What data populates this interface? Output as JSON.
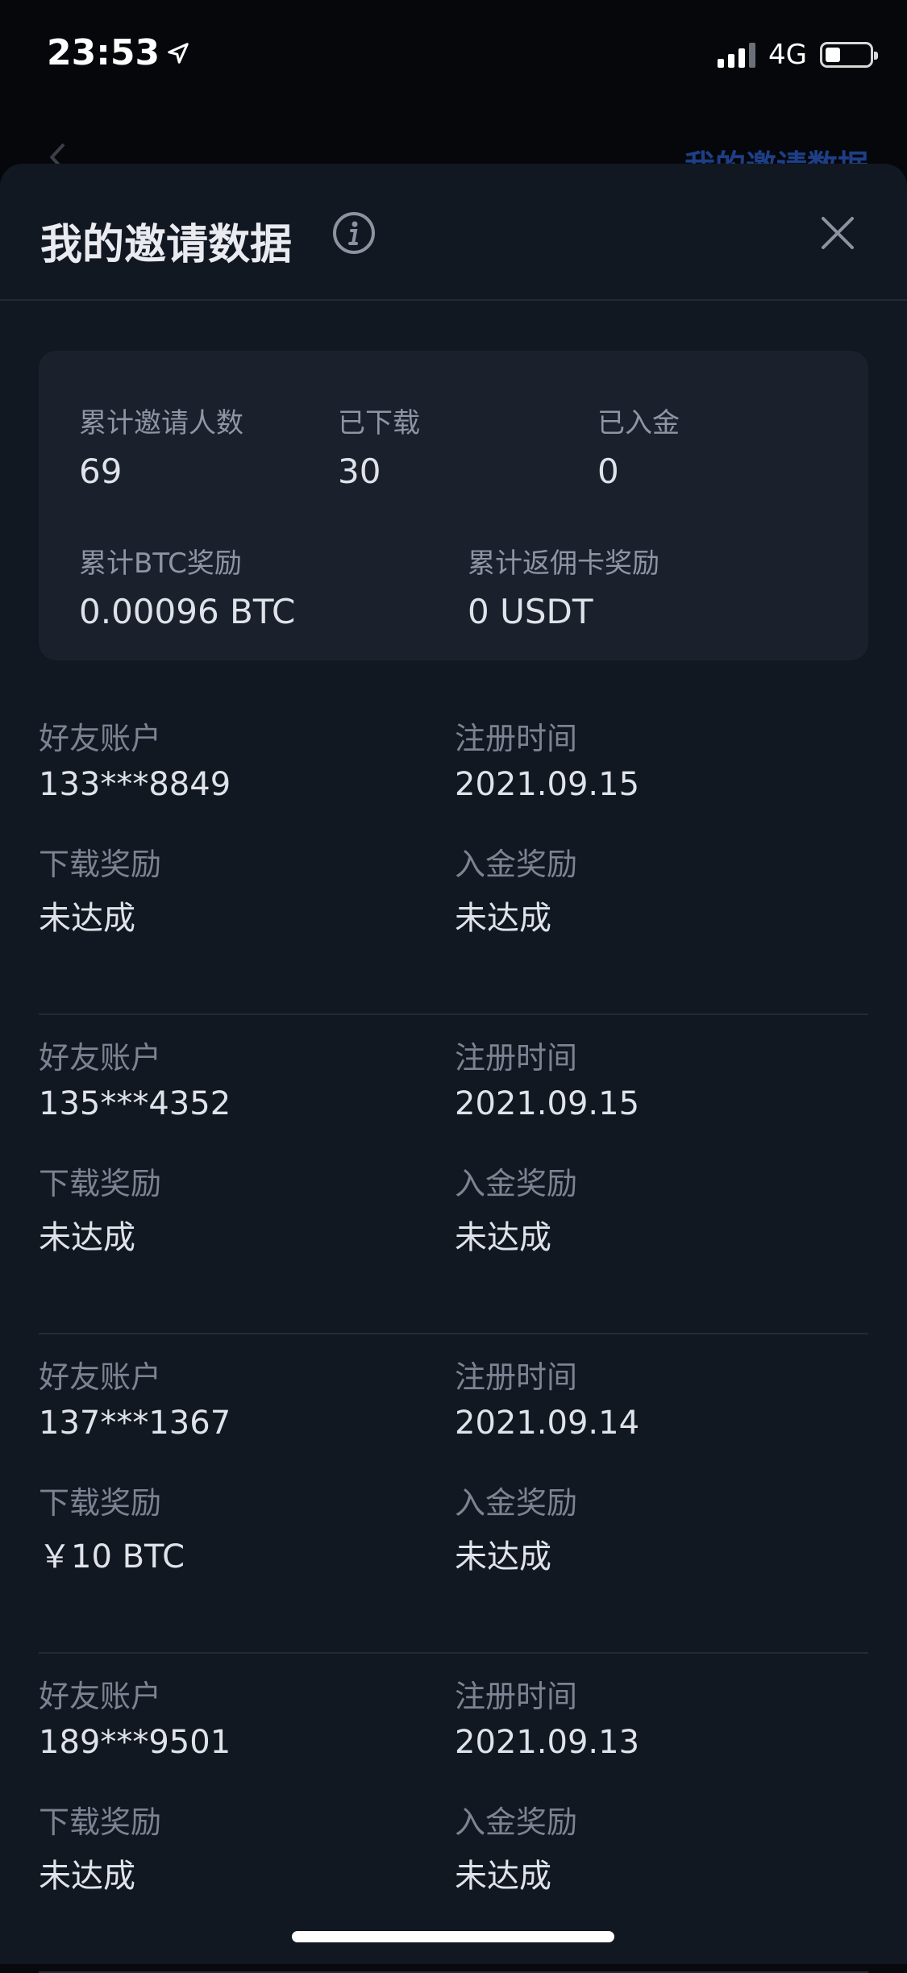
{
  "status": {
    "time": "23:53",
    "network": "4G",
    "battery_level": 0.35
  },
  "background_page": {
    "title": "我的邀请数据"
  },
  "sheet": {
    "title": "我的邀请数据"
  },
  "summary": {
    "invited_label": "累计邀请人数",
    "invited_value": "69",
    "downloaded_label": "已下载",
    "downloaded_value": "30",
    "deposited_label": "已入金",
    "deposited_value": "0",
    "btc_reward_label": "累计BTC奖励",
    "btc_reward_value": "0.00096 BTC",
    "card_reward_label": "累计返佣卡奖励",
    "card_reward_value": "0 USDT"
  },
  "record_labels": {
    "account": "好友账户",
    "register_time": "注册时间",
    "download_reward": "下载奖励",
    "deposit_reward": "入金奖励"
  },
  "records": [
    {
      "account": "133***8849",
      "register_time": "2021.09.15",
      "download_reward": "未达成",
      "deposit_reward": "未达成"
    },
    {
      "account": "135***4352",
      "register_time": "2021.09.15",
      "download_reward": "未达成",
      "deposit_reward": "未达成"
    },
    {
      "account": "137***1367",
      "register_time": "2021.09.14",
      "download_reward": "￥10 BTC",
      "deposit_reward": "未达成"
    },
    {
      "account": "189***9501",
      "register_time": "2021.09.13",
      "download_reward": "未达成",
      "deposit_reward": "未达成"
    }
  ]
}
